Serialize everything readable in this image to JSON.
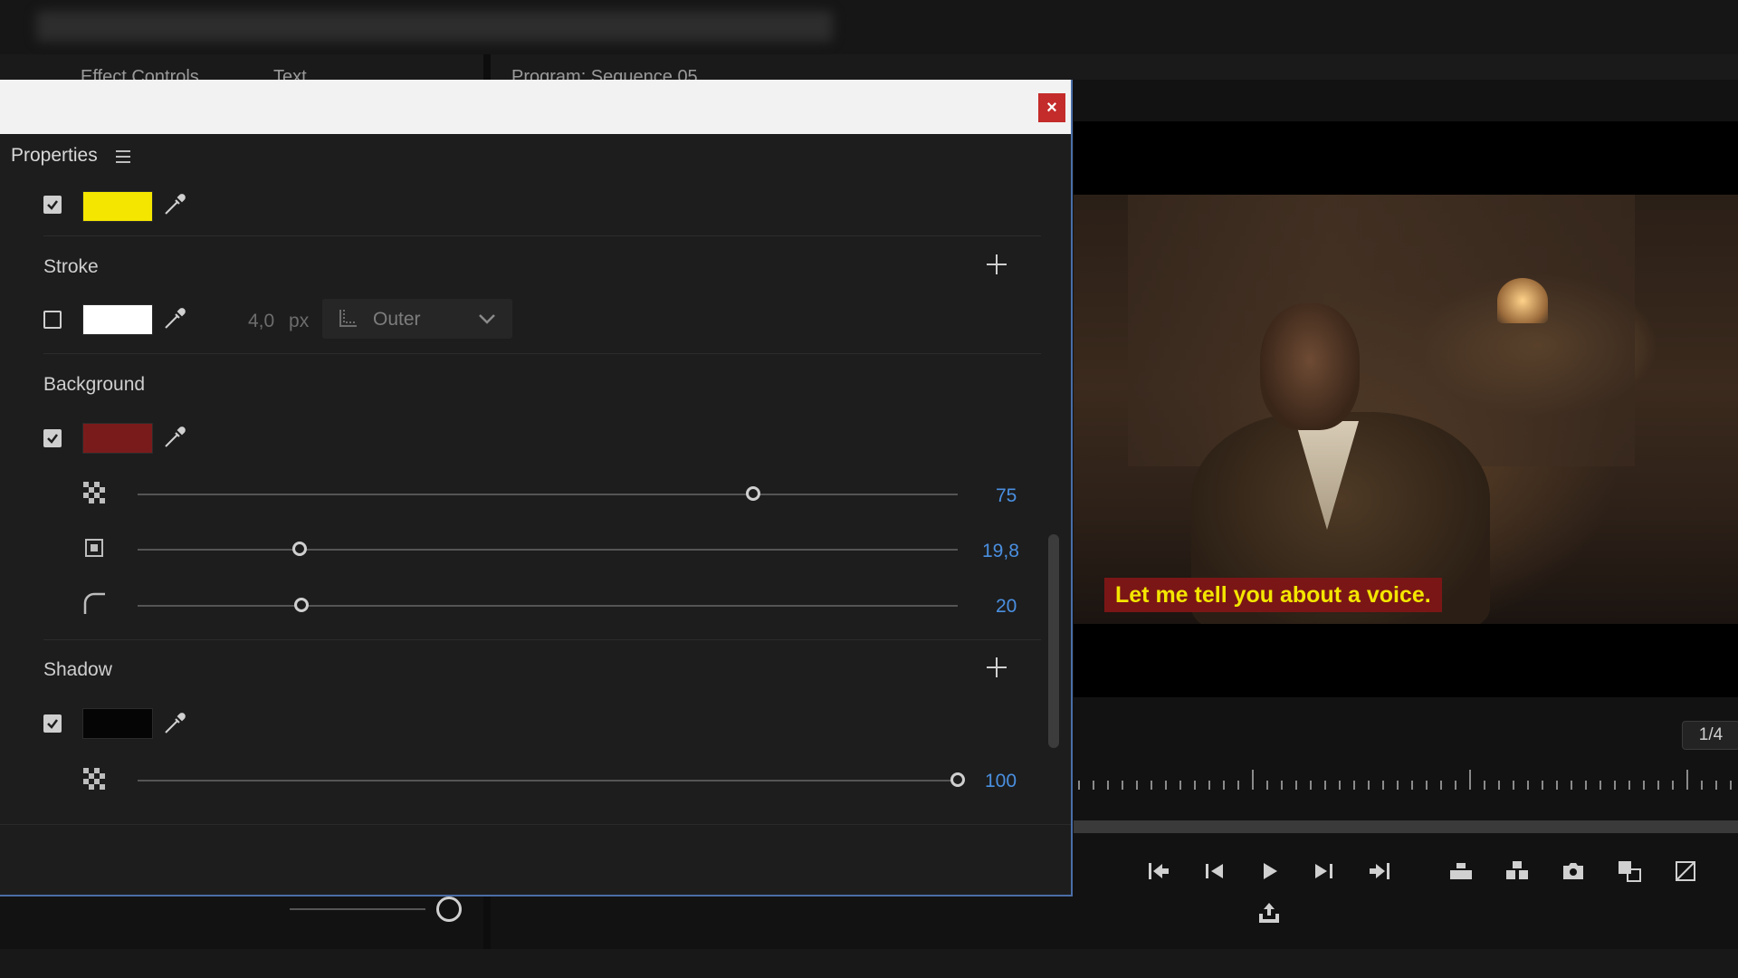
{
  "window": {
    "panels": [
      "Effect Controls",
      "Text",
      "Program: Sequence 05"
    ]
  },
  "dialog": {
    "close_label": "×",
    "properties_title": "Properties",
    "fill": {
      "checked": true,
      "color": "#f5e600"
    },
    "stroke": {
      "label": "Stroke",
      "checked": false,
      "color": "#ffffff",
      "width_value": "4,0",
      "width_unit": "px",
      "position": "Outer"
    },
    "background": {
      "label": "Background",
      "checked": true,
      "color": "#7a1b1b",
      "opacity": {
        "value": "75",
        "fraction": 0.75
      },
      "size": {
        "value": "19,8",
        "fraction": 0.198
      },
      "corner_radius": {
        "value": "20",
        "fraction": 0.2
      }
    },
    "shadow": {
      "label": "Shadow",
      "checked": true,
      "color": "#050505",
      "opacity": {
        "value": "100",
        "fraction": 1.0
      }
    }
  },
  "monitor": {
    "caption": "Let me tell you about a voice.",
    "caption_bg": "#7b1616",
    "caption_color": "#f4e600",
    "page_indicator": "1/4"
  },
  "icons": {
    "transport": [
      "mark-in-icon",
      "step-back-icon",
      "play-icon",
      "step-forward-icon",
      "go-to-out-icon",
      "lift-icon",
      "extract-icon",
      "export-frame-icon",
      "comparison-view-icon",
      "multi-camera-icon",
      "export-icon"
    ]
  }
}
